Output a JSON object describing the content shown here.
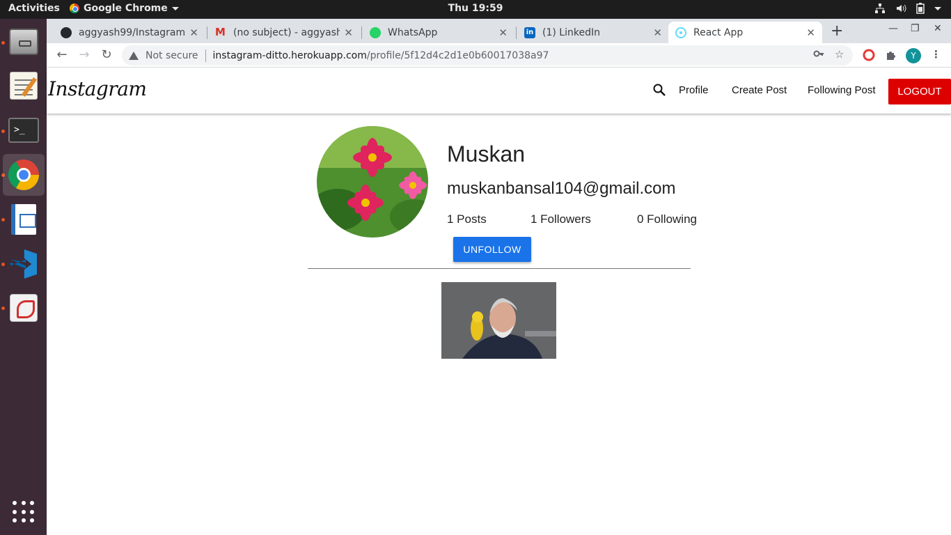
{
  "system": {
    "activities": "Activities",
    "app_name": "Google Chrome",
    "clock": "Thu 19:59"
  },
  "browser": {
    "tabs": [
      {
        "title": "aggyash99/Instagram-",
        "favicon": "github-icon",
        "active": false
      },
      {
        "title": "(no subject) - aggyash9",
        "favicon": "gmail-icon",
        "active": false
      },
      {
        "title": "WhatsApp",
        "favicon": "whatsapp-icon",
        "active": false
      },
      {
        "title": "(1) LinkedIn",
        "favicon": "linkedin-icon",
        "active": false
      },
      {
        "title": "React App",
        "favicon": "react-icon",
        "active": true
      }
    ],
    "security_label": "Not secure",
    "url_host": "instagram-ditto.herokuapp.com",
    "url_path": "/profile/5f12d4c2d1e0b60017038a97",
    "profile_initial": "Y"
  },
  "app": {
    "brand": "Instagram",
    "nav": {
      "profile": "Profile",
      "create_post": "Create Post",
      "following_post": "Following Post",
      "logout": "LOGOUT"
    },
    "profile": {
      "name": "Muskan",
      "email": "muskanbansal104@gmail.com",
      "posts": "1 Posts",
      "followers": "1 Followers",
      "following": "0 Following",
      "unfollow_label": "UNFOLLOW"
    }
  },
  "colors": {
    "logout_bg": "#dd0000",
    "unfollow_bg": "#1a73e8",
    "dock_bg": "#3c2a36"
  }
}
